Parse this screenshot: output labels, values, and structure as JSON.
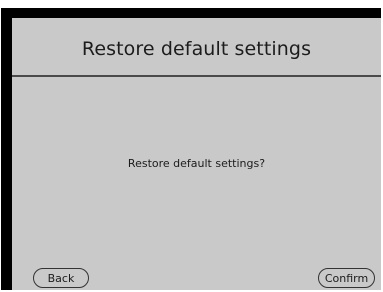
{
  "dialog": {
    "title": "Restore default settings",
    "message": "Restore default settings?",
    "back_label": "Back",
    "confirm_label": "Confirm"
  },
  "colors": {
    "screen_background": "#c9c9c9",
    "bezel": "#000000",
    "text": "#1c1c1c",
    "divider": "#4a4a4a"
  }
}
